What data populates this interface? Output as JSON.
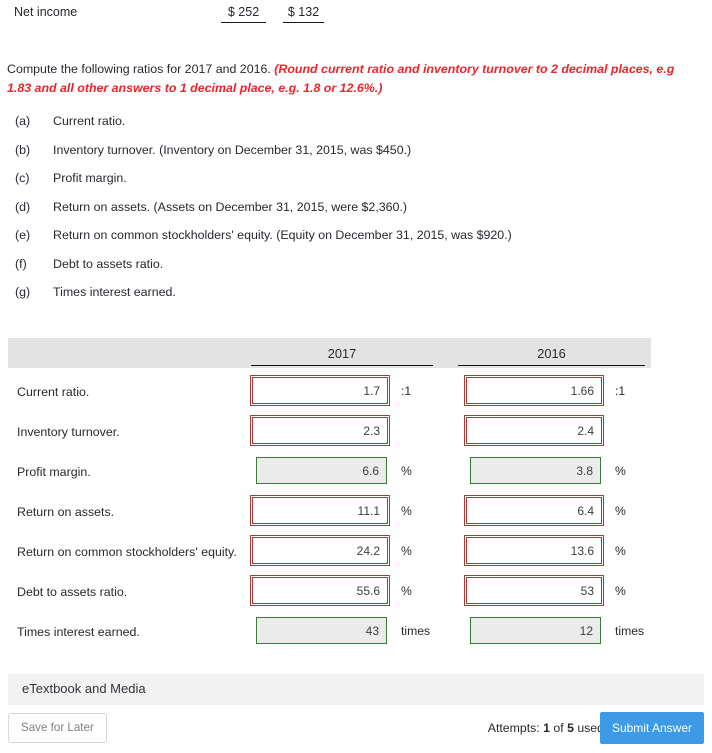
{
  "net_income": {
    "label": "Net income",
    "value_2017": "$ 252",
    "value_2016": "$ 132"
  },
  "instruction": {
    "main": "Compute the following ratios for 2017 and 2016. ",
    "hint": "(Round current ratio and inventory turnover to 2 decimal places, e.g 1.83 and all other answers to 1 decimal place, e.g. 1.8 or 12.6%.)"
  },
  "questions": [
    {
      "letter": "(a)",
      "text": "Current ratio."
    },
    {
      "letter": "(b)",
      "text": "Inventory turnover. (Inventory on December 31, 2015, was $450.)"
    },
    {
      "letter": "(c)",
      "text": "Profit margin."
    },
    {
      "letter": "(d)",
      "text": "Return on assets. (Assets on December 31, 2015, were $2,360.)"
    },
    {
      "letter": "(e)",
      "text": "Return on common stockholders' equity. (Equity on December 31, 2015, was $920.)"
    },
    {
      "letter": "(f)",
      "text": "Debt to assets ratio."
    },
    {
      "letter": "(g)",
      "text": "Times interest earned."
    }
  ],
  "table": {
    "headers": [
      "",
      "2017",
      "2016"
    ],
    "rows": [
      {
        "label": "Current ratio.",
        "v2017": "1.7",
        "s2017": "wrong",
        "u2017": ":1",
        "v2016": "1.66",
        "s2016": "wrong",
        "u2016": ":1"
      },
      {
        "label": "Inventory turnover.",
        "v2017": "2.3",
        "s2017": "wrong",
        "u2017": "",
        "v2016": "2.4",
        "s2016": "wrong",
        "u2016": ""
      },
      {
        "label": "Profit margin.",
        "v2017": "6.6",
        "s2017": "ok",
        "u2017": "%",
        "v2016": "3.8",
        "s2016": "ok",
        "u2016": "%"
      },
      {
        "label": "Return on assets.",
        "v2017": "11.1",
        "s2017": "wrong",
        "u2017": "%",
        "v2016": "6.4",
        "s2016": "wrong",
        "u2016": "%"
      },
      {
        "label": "Return on common stockholders' equity.",
        "v2017": "24.2",
        "s2017": "wrong",
        "u2017": "%",
        "v2016": "13.6",
        "s2016": "wrong",
        "u2016": "%"
      },
      {
        "label": "Debt to assets ratio.",
        "v2017": "55.6",
        "s2017": "wrong",
        "u2017": "%",
        "v2016": "53",
        "s2016": "wrong",
        "u2016": "%"
      },
      {
        "label": "Times interest earned.",
        "v2017": "43",
        "s2017": "ok",
        "u2017": "times",
        "v2016": "12",
        "s2016": "ok",
        "u2016": "times"
      }
    ]
  },
  "footer": {
    "etextbook_label": "eTextbook and Media",
    "save_label": "Save for Later",
    "attempts_prefix": "Attempts: ",
    "attempts_used": "1",
    "attempts_mid": " of ",
    "attempts_total": "5",
    "attempts_suffix": " used",
    "submit_label": "Submit Answer"
  },
  "colors": {
    "error_border": "#a03c39",
    "correct_border": "#3c7a3c",
    "correct_fill": "#ebebeb",
    "header_band": "#e3e3e3",
    "hint_red": "#e8262b",
    "submit_blue": "#3d9ae5"
  }
}
